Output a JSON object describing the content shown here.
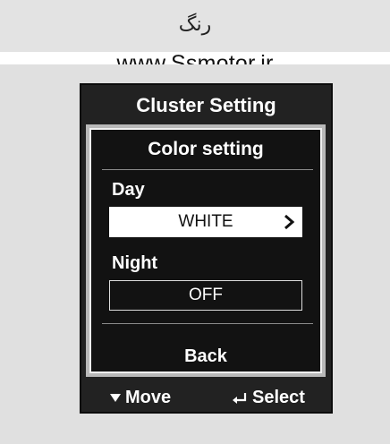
{
  "header": {
    "title": "رنگ"
  },
  "watermark": "www.Ssmotor.ir",
  "device": {
    "title": "Cluster Setting",
    "screen": {
      "title": "Color setting",
      "day": {
        "label": "Day",
        "value": "WHITE",
        "selected": true
      },
      "night": {
        "label": "Night",
        "value": "OFF",
        "selected": false
      },
      "back_label": "Back"
    },
    "footer": {
      "move_label": "Move",
      "move_icon": "triangle-down-icon",
      "select_label": "Select",
      "select_icon": "enter-return-icon"
    }
  },
  "colors": {
    "header_bg": "#e3e3e3",
    "device_bg": "#222222",
    "screen_bg": "#121212",
    "selected_bg": "#ffffff"
  }
}
